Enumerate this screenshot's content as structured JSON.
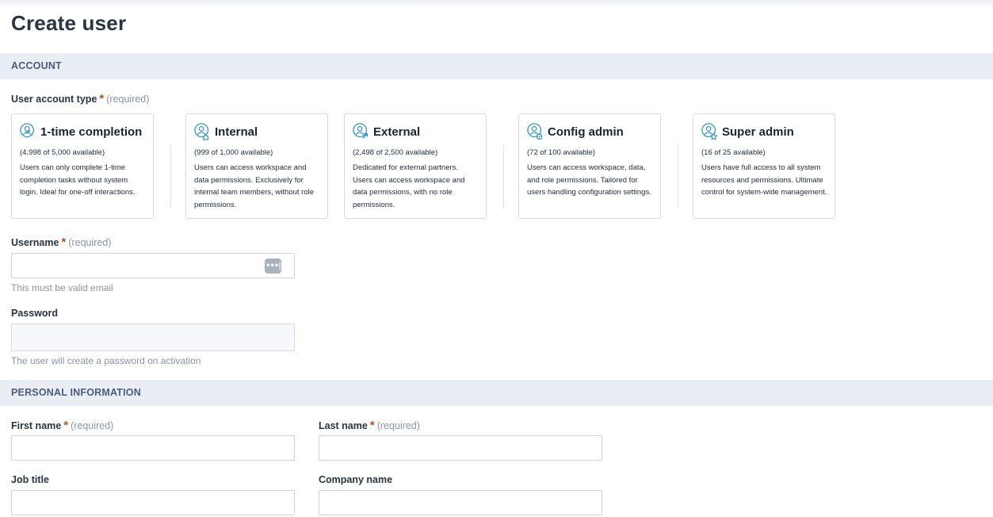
{
  "page": {
    "title": "Create user"
  },
  "sections": {
    "account": "ACCOUNT",
    "personal": "PERSONAL INFORMATION"
  },
  "required_text": "(required)",
  "required_star": "*",
  "account_type": {
    "label": "User account type",
    "options": [
      {
        "title": "1-time completion",
        "available": "(4,998 of 5,000 available)",
        "description": "Users can only complete 1-time completion tasks without system login. Ideal for one-off interactions.",
        "icon": "user-check-icon"
      },
      {
        "title": "Internal",
        "available": "(999 of 1,000 available)",
        "description": "Users can access workspace and data permissions. Exclusively for internal team members, without role permissions.",
        "icon": "user-home-icon"
      },
      {
        "title": "External",
        "available": "(2,498 of 2,500 available)",
        "description": "Dedicated for external partners. Users can access workspace and data permissions, with no role permissions.",
        "icon": "user-external-icon"
      },
      {
        "title": "Config admin",
        "available": "(72 of 100 available)",
        "description": "Users can access workspace, data, and role permissions. Tailored for users handling configuration settings.",
        "icon": "user-gear-icon"
      },
      {
        "title": "Super admin",
        "available": "(16 of 25 available)",
        "description": "Users have full access to all system resources and permissions. Ultimate control for system-wide management.",
        "icon": "user-star-icon"
      }
    ]
  },
  "username": {
    "label": "Username",
    "value": "",
    "hint": "This must be valid email",
    "badge": "•••|"
  },
  "password": {
    "label": "Password",
    "value": "",
    "hint": "The user will create a password on activation"
  },
  "first_name": {
    "label": "First name",
    "value": ""
  },
  "last_name": {
    "label": "Last name",
    "value": ""
  },
  "job_title": {
    "label": "Job title",
    "value": ""
  },
  "company_name": {
    "label": "Company name",
    "value": ""
  },
  "colors": {
    "accent": "#1f8fc9",
    "required": "#b3532a",
    "section_bg": "#e9edf4"
  }
}
